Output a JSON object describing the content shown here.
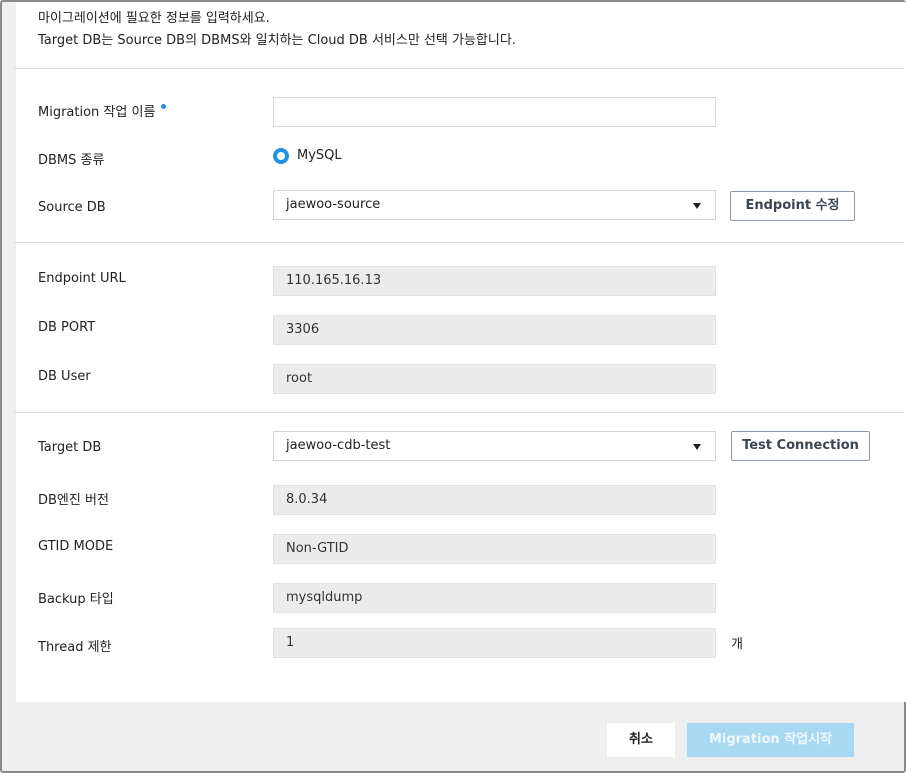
{
  "intro": {
    "line1": "마이그레이션에 필요한 정보를 입력하세요.",
    "line2": "Target DB는 Source DB의 DBMS와 일치하는 Cloud DB 서비스만 선택 가능합니다."
  },
  "form": {
    "migration_name": {
      "label": "Migration 작업 이름",
      "value": "",
      "required": true
    },
    "dbms_type": {
      "label": "DBMS 종류",
      "option": "MySQL",
      "selected": true
    },
    "source_db": {
      "label": "Source DB",
      "value": "jaewoo-source",
      "endpoint_button": "Endpoint 수정"
    },
    "endpoint_url": {
      "label": "Endpoint URL",
      "value": "110.165.16.13"
    },
    "db_port": {
      "label": "DB PORT",
      "value": "3306"
    },
    "db_user": {
      "label": "DB User",
      "value": "root"
    },
    "target_db": {
      "label": "Target DB",
      "value": "jaewoo-cdb-test",
      "test_button": "Test Connection"
    },
    "db_engine_version": {
      "label": "DB엔진 버전",
      "value": "8.0.34"
    },
    "gtid_mode": {
      "label": "GTID MODE",
      "value": "Non-GTID"
    },
    "backup_type": {
      "label": "Backup 타입",
      "value": "mysqldump"
    },
    "thread_limit": {
      "label": "Thread 제한",
      "value": "1",
      "unit": "개"
    }
  },
  "footer": {
    "cancel_label": "취소",
    "start_label": "Migration 작업시작"
  },
  "colors": {
    "accent": "#1f95e0",
    "primary_disabled": "#a9d8f3",
    "readonly_bg": "#ececec"
  }
}
